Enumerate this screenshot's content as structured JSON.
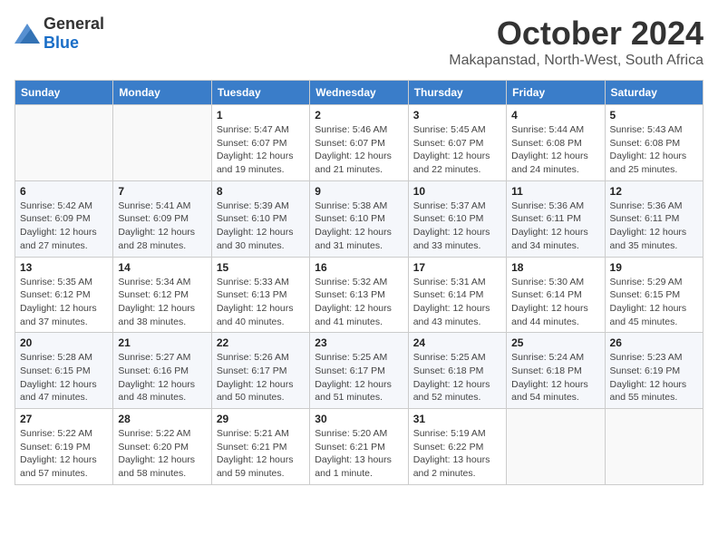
{
  "logo": {
    "general": "General",
    "blue": "Blue"
  },
  "title": "October 2024",
  "location": "Makapanstad, North-West, South Africa",
  "weekdays": [
    "Sunday",
    "Monday",
    "Tuesday",
    "Wednesday",
    "Thursday",
    "Friday",
    "Saturday"
  ],
  "weeks": [
    [
      {
        "day": "",
        "info": ""
      },
      {
        "day": "",
        "info": ""
      },
      {
        "day": "1",
        "info": "Sunrise: 5:47 AM\nSunset: 6:07 PM\nDaylight: 12 hours and 19 minutes."
      },
      {
        "day": "2",
        "info": "Sunrise: 5:46 AM\nSunset: 6:07 PM\nDaylight: 12 hours and 21 minutes."
      },
      {
        "day": "3",
        "info": "Sunrise: 5:45 AM\nSunset: 6:07 PM\nDaylight: 12 hours and 22 minutes."
      },
      {
        "day": "4",
        "info": "Sunrise: 5:44 AM\nSunset: 6:08 PM\nDaylight: 12 hours and 24 minutes."
      },
      {
        "day": "5",
        "info": "Sunrise: 5:43 AM\nSunset: 6:08 PM\nDaylight: 12 hours and 25 minutes."
      }
    ],
    [
      {
        "day": "6",
        "info": "Sunrise: 5:42 AM\nSunset: 6:09 PM\nDaylight: 12 hours and 27 minutes."
      },
      {
        "day": "7",
        "info": "Sunrise: 5:41 AM\nSunset: 6:09 PM\nDaylight: 12 hours and 28 minutes."
      },
      {
        "day": "8",
        "info": "Sunrise: 5:39 AM\nSunset: 6:10 PM\nDaylight: 12 hours and 30 minutes."
      },
      {
        "day": "9",
        "info": "Sunrise: 5:38 AM\nSunset: 6:10 PM\nDaylight: 12 hours and 31 minutes."
      },
      {
        "day": "10",
        "info": "Sunrise: 5:37 AM\nSunset: 6:10 PM\nDaylight: 12 hours and 33 minutes."
      },
      {
        "day": "11",
        "info": "Sunrise: 5:36 AM\nSunset: 6:11 PM\nDaylight: 12 hours and 34 minutes."
      },
      {
        "day": "12",
        "info": "Sunrise: 5:36 AM\nSunset: 6:11 PM\nDaylight: 12 hours and 35 minutes."
      }
    ],
    [
      {
        "day": "13",
        "info": "Sunrise: 5:35 AM\nSunset: 6:12 PM\nDaylight: 12 hours and 37 minutes."
      },
      {
        "day": "14",
        "info": "Sunrise: 5:34 AM\nSunset: 6:12 PM\nDaylight: 12 hours and 38 minutes."
      },
      {
        "day": "15",
        "info": "Sunrise: 5:33 AM\nSunset: 6:13 PM\nDaylight: 12 hours and 40 minutes."
      },
      {
        "day": "16",
        "info": "Sunrise: 5:32 AM\nSunset: 6:13 PM\nDaylight: 12 hours and 41 minutes."
      },
      {
        "day": "17",
        "info": "Sunrise: 5:31 AM\nSunset: 6:14 PM\nDaylight: 12 hours and 43 minutes."
      },
      {
        "day": "18",
        "info": "Sunrise: 5:30 AM\nSunset: 6:14 PM\nDaylight: 12 hours and 44 minutes."
      },
      {
        "day": "19",
        "info": "Sunrise: 5:29 AM\nSunset: 6:15 PM\nDaylight: 12 hours and 45 minutes."
      }
    ],
    [
      {
        "day": "20",
        "info": "Sunrise: 5:28 AM\nSunset: 6:15 PM\nDaylight: 12 hours and 47 minutes."
      },
      {
        "day": "21",
        "info": "Sunrise: 5:27 AM\nSunset: 6:16 PM\nDaylight: 12 hours and 48 minutes."
      },
      {
        "day": "22",
        "info": "Sunrise: 5:26 AM\nSunset: 6:17 PM\nDaylight: 12 hours and 50 minutes."
      },
      {
        "day": "23",
        "info": "Sunrise: 5:25 AM\nSunset: 6:17 PM\nDaylight: 12 hours and 51 minutes."
      },
      {
        "day": "24",
        "info": "Sunrise: 5:25 AM\nSunset: 6:18 PM\nDaylight: 12 hours and 52 minutes."
      },
      {
        "day": "25",
        "info": "Sunrise: 5:24 AM\nSunset: 6:18 PM\nDaylight: 12 hours and 54 minutes."
      },
      {
        "day": "26",
        "info": "Sunrise: 5:23 AM\nSunset: 6:19 PM\nDaylight: 12 hours and 55 minutes."
      }
    ],
    [
      {
        "day": "27",
        "info": "Sunrise: 5:22 AM\nSunset: 6:19 PM\nDaylight: 12 hours and 57 minutes."
      },
      {
        "day": "28",
        "info": "Sunrise: 5:22 AM\nSunset: 6:20 PM\nDaylight: 12 hours and 58 minutes."
      },
      {
        "day": "29",
        "info": "Sunrise: 5:21 AM\nSunset: 6:21 PM\nDaylight: 12 hours and 59 minutes."
      },
      {
        "day": "30",
        "info": "Sunrise: 5:20 AM\nSunset: 6:21 PM\nDaylight: 13 hours and 1 minute."
      },
      {
        "day": "31",
        "info": "Sunrise: 5:19 AM\nSunset: 6:22 PM\nDaylight: 13 hours and 2 minutes."
      },
      {
        "day": "",
        "info": ""
      },
      {
        "day": "",
        "info": ""
      }
    ]
  ]
}
